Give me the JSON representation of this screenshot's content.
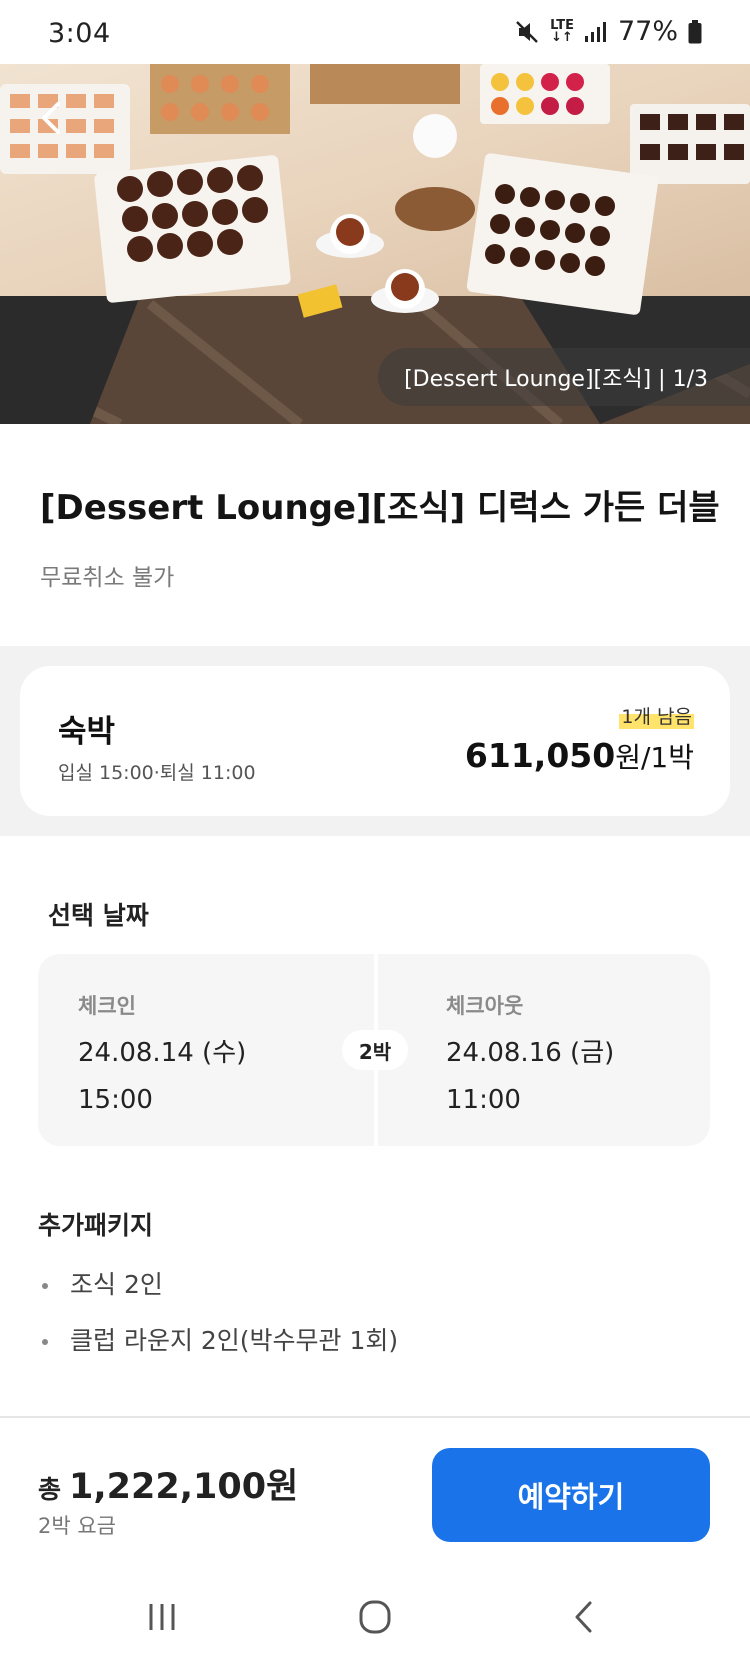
{
  "status_bar": {
    "time": "3:04",
    "network": "LTE",
    "battery": "77%"
  },
  "hero": {
    "counter": "[Dessert Lounge][조식] | 1/3",
    "icons": [
      "back-arrow-icon"
    ]
  },
  "room": {
    "title": "[Dessert Lounge][조식] 디럭스 가든 더블",
    "cancellation": "무료취소 불가"
  },
  "stay_card": {
    "label": "숙박",
    "times": "입실 15:00·퇴실 11:00",
    "remaining": "1개 남음",
    "price": "611,050",
    "price_unit": "원",
    "per_night": "/1박"
  },
  "dates": {
    "heading": "선택 날짜",
    "checkin_label": "체크인",
    "checkin_date": "24.08.14 (수)",
    "checkin_time": "15:00",
    "nights": "2박",
    "checkout_label": "체크아웃",
    "checkout_date": "24.08.16 (금)",
    "checkout_time": "11:00"
  },
  "packages": {
    "heading": "추가패키지",
    "items": [
      "조식 2인",
      "클럽 라운지 2인(박수무관 1회)"
    ]
  },
  "footer": {
    "total_prefix": "총",
    "total_amount": "1,222,100원",
    "total_sub": "2박 요금",
    "reserve_label": "예약하기"
  },
  "colors": {
    "accent": "#1a73e8",
    "highlight": "#ffe36b",
    "band": "#f2f2f2"
  }
}
